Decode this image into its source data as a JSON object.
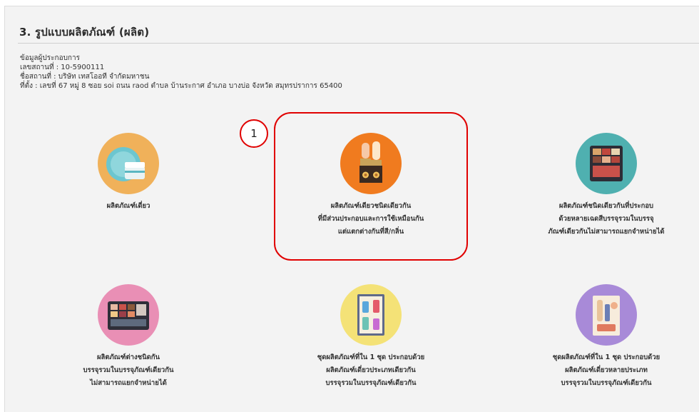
{
  "section": {
    "title": "3. รูปแบบผลิตภัณฑ์ (ผลิต)"
  },
  "operator": {
    "heading": "ข้อมูลผู้ประกอบการ",
    "place_no": "เลขสถานที่ : 10-5900111",
    "place_name": "ชื่อสถานที่ : บริษัท เทสโออที จำกัดมหาชน",
    "address": "ที่ตั้ง : เลขที่ 67 หมู่ 8 ซอย soi ถนน raod ตำบล บ้านระกาศ อำเภอ บางบ่อ จังหวัด สมุทรปราการ 65400"
  },
  "step_badge": "1",
  "products": [
    {
      "icon": "cream-jar-icon",
      "color": "#f0b15a",
      "lines": [
        "ผลิตภัณฑ์เดี่ยว"
      ]
    },
    {
      "icon": "lipstick-icon",
      "color": "#f07b1f",
      "lines": [
        "ผลิตภัณฑ์เดียวชนิดเดียวกัน",
        "ที่มีส่วนประกอบและการใช้เหมือนกัน",
        "แต่แตกต่างกันที่สี/กลิ่น"
      ]
    },
    {
      "icon": "eyeshadow-palette-icon",
      "color": "#4fb0b0",
      "lines": [
        "ผลิตภัณฑ์ชนิดเดียวกันที่ประกอบ",
        "ด้วยหลายเฉดสีบรรจุรวมในบรรจุ",
        "ภัณฑ์เดียวกันไม่สามารถแยกจำหน่ายได้"
      ]
    },
    {
      "icon": "makeup-kit-icon",
      "color": "#e98fb5",
      "lines": [
        "ผลิตภัณฑ์ต่างชนิดกัน",
        "บรรจุรวมในบรรจุภัณฑ์เดียวกัน",
        "ไม่สามารถแยกจำหน่ายได้"
      ]
    },
    {
      "icon": "bottle-set-icon",
      "color": "#f4e277",
      "lines": [
        "ชุดผลิตภัณฑ์ที่ใน 1 ชุด ประกอบด้วย",
        "ผลิตภัณฑ์เดี่ยวประเภทเดียวกัน",
        "บรรจุรวมในบรรจุภัณฑ์เดียวกัน"
      ]
    },
    {
      "icon": "cosmetic-set-icon",
      "color": "#a88ad8",
      "lines": [
        "ชุดผลิตภัณฑ์ที่ใน 1 ชุด ประกอบด้วย",
        "ผลิตภัณฑ์เดี่ยวหลายประเภท",
        "บรรจุรวมในบรรจุภัณฑ์เดียวกัน"
      ]
    }
  ]
}
